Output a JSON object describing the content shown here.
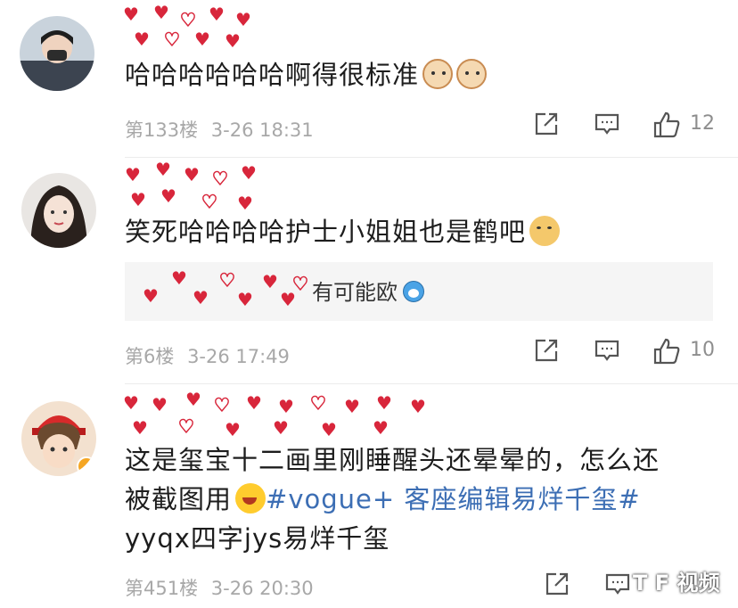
{
  "colors": {
    "heart": "#d8263b",
    "topic": "#3c6eb4",
    "meta": "#a8a8a8",
    "reply_bg": "#f5f5f5"
  },
  "comments": [
    {
      "text": "哈哈哈哈哈哈啊得很标准",
      "emojis": [
        "cat-face-emoji",
        "cat-face-emoji"
      ],
      "floor": "第133楼",
      "time": "3-26 18:31",
      "likes": "12"
    },
    {
      "text": "笑死哈哈哈哈护士小姐姐也是鹤吧",
      "emojis": [
        "doge-emoji"
      ],
      "reply": {
        "text": "有可能欧",
        "icon": "doraemon-icon"
      },
      "floor": "第6楼",
      "time": "3-26 17:49",
      "likes": "10"
    },
    {
      "text_line1": "这是玺宝十二画里刚睡醒头还晕晕的，怎么还",
      "text_line2_a": "被截图用",
      "emoji": "rofl-emoji",
      "topic": "#vogue+ 客座编辑易烊千玺#",
      "text_line3": "yyqx四字jys易烊千玺",
      "floor": "第451楼",
      "time": "3-26 20:30"
    }
  ],
  "icons": {
    "share": "share-icon",
    "comment": "comment-icon",
    "like": "thumbs-up-icon"
  },
  "watermark": "T F 视频"
}
